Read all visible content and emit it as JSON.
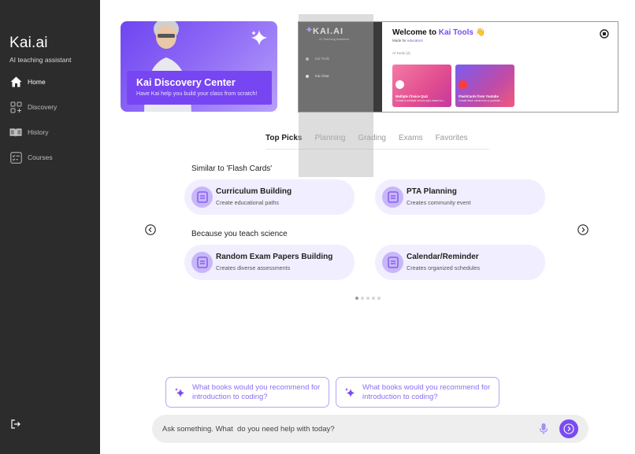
{
  "sidebar": {
    "brand": "Kai.ai",
    "subtitle": "AI teaching assistant",
    "items": [
      {
        "label": "Home",
        "icon": "home-icon"
      },
      {
        "label": "Discovery",
        "icon": "grid-icon"
      },
      {
        "label": "History",
        "icon": "book-icon"
      },
      {
        "label": "Courses",
        "icon": "checklist-icon"
      }
    ],
    "logout_icon": "logout-icon"
  },
  "banner_left": {
    "title": "Kai Discovery Center",
    "subtitle": "Have Kai help you build your class from scratch!"
  },
  "banner_right": {
    "logo": "KAI.AI",
    "logo_sub": "AI Teaching Assistant",
    "nav": [
      "Kai Tools",
      "Kai Chat"
    ],
    "title_prefix": "Welcome to ",
    "title_highlight": "Kai Tools",
    "title_emoji": "👋",
    "made_prefix": "Made for ",
    "made_highlight": "educators",
    "tools_label": "AI Tools (2)",
    "cards": [
      {
        "name": "Multiple Choice Quiz",
        "desc": "Create a multiple choice quiz based on..."
      },
      {
        "name": "FlashCards from Youtube",
        "desc": "Create flash cards from a youtube..."
      }
    ]
  },
  "tabs": [
    "Top Picks",
    "Planning",
    "Grading",
    "Exams",
    "Favorites"
  ],
  "active_tab": "Top Picks",
  "sections": [
    {
      "title": "Similar to 'Flash Cards'",
      "cards": [
        {
          "title": "Curriculum Building",
          "sub": "Create educational paths"
        },
        {
          "title": "PTA Planning",
          "sub": "Creates community event"
        }
      ]
    },
    {
      "title": "Because you teach science",
      "cards": [
        {
          "title": "Random Exam Papers Building",
          "sub": "Creates diverse assessments"
        },
        {
          "title": "Calendar/Reminder",
          "sub": "Creates organized schedules"
        }
      ]
    }
  ],
  "pagination": {
    "count": 5,
    "active": 1
  },
  "suggestions": [
    "What books would you recommend for introduction to coding?",
    "What books would you recommend for introduction to coding?"
  ],
  "input": {
    "placeholder": "Ask something. What  do you need help with today?"
  },
  "colors": {
    "sidebar": "#2c2c2c",
    "accent": "#7a4cf0",
    "card_bg": "#f1efff",
    "chip_border": "#b9a3f4"
  }
}
